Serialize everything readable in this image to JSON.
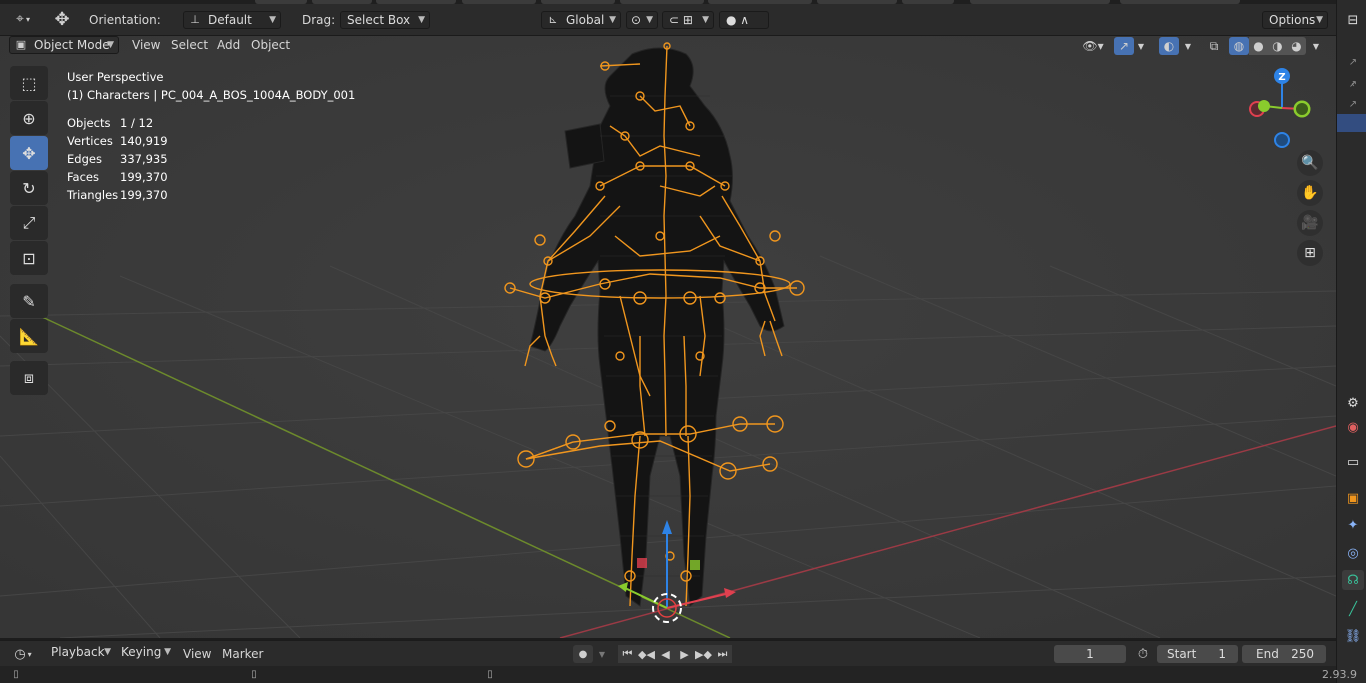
{
  "header": {
    "orientation_label": "Orientation:",
    "orientation_value": "Default",
    "drag_label": "Drag:",
    "drag_value": "Select Box",
    "transform_space": "Global",
    "options_label": "Options"
  },
  "viewport_header": {
    "mode": "Object Mode",
    "menus": [
      "View",
      "Select",
      "Add",
      "Object"
    ]
  },
  "overlay": {
    "perspective": "User Perspective",
    "collection": "(1) Characters | PC_004_A_BOS_1004A_BODY_001",
    "stats": [
      {
        "key": "Objects",
        "value": "1 / 12"
      },
      {
        "key": "Vertices",
        "value": "140,919"
      },
      {
        "key": "Edges",
        "value": "337,935"
      },
      {
        "key": "Faces",
        "value": "199,370"
      },
      {
        "key": "Triangles",
        "value": "199,370"
      }
    ]
  },
  "gizmo": {
    "z_label": "Z"
  },
  "timeline": {
    "menus": [
      "Playback",
      "Keying",
      "View",
      "Marker"
    ],
    "current_frame": "1",
    "start_label": "Start",
    "start_value": "1",
    "end_label": "End",
    "end_value": "250"
  },
  "status_bar": {
    "version": "2.93.9"
  },
  "colors": {
    "accent": "#4772b3",
    "bone": "#f0961e",
    "x_axis": "#e0404f",
    "y_axis": "#8acb2d",
    "z_axis": "#2e83e6"
  }
}
